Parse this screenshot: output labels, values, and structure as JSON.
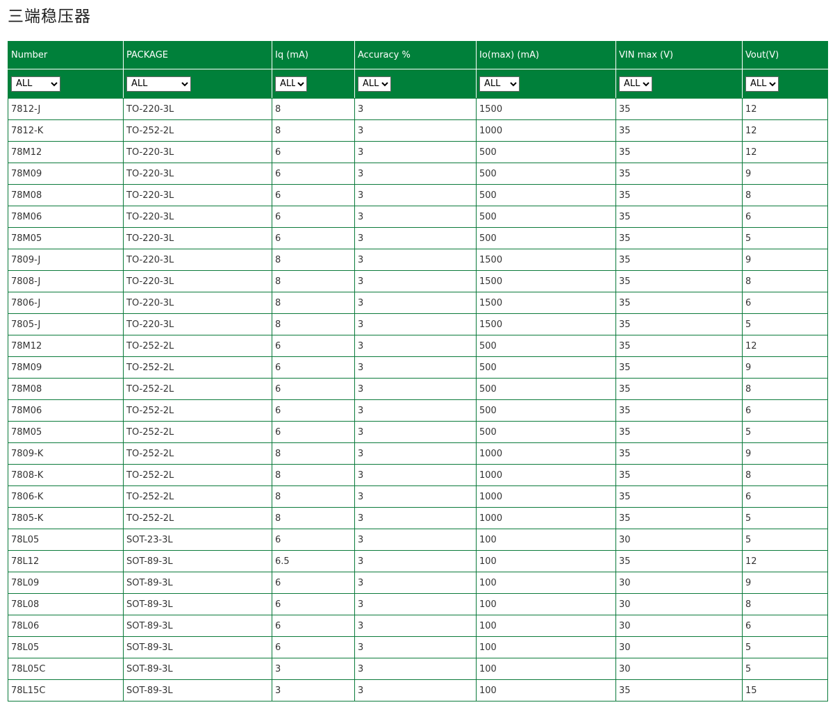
{
  "page": {
    "title": "三端稳压器"
  },
  "table": {
    "columns": [
      {
        "key": "number",
        "label": "Number",
        "filter": "ALL"
      },
      {
        "key": "package",
        "label": "PACKAGE",
        "filter": "ALL"
      },
      {
        "key": "iq",
        "label": "Iq (mA)",
        "filter": "ALL"
      },
      {
        "key": "accuracy",
        "label": "Accuracy %",
        "filter": "ALL"
      },
      {
        "key": "iomax",
        "label": "Io(max) (mA)",
        "filter": "ALL"
      },
      {
        "key": "vinmax",
        "label": "VIN max (V)",
        "filter": "ALL"
      },
      {
        "key": "vout",
        "label": "Vout(V)",
        "filter": "ALL"
      }
    ],
    "rows": [
      [
        "7812-J",
        "TO-220-3L",
        "8",
        "3",
        "1500",
        "35",
        "12"
      ],
      [
        "7812-K",
        "TO-252-2L",
        "8",
        "3",
        "1000",
        "35",
        "12"
      ],
      [
        "78M12",
        "TO-220-3L",
        "6",
        "3",
        "500",
        "35",
        "12"
      ],
      [
        "78M09",
        "TO-220-3L",
        "6",
        "3",
        "500",
        "35",
        "9"
      ],
      [
        "78M08",
        "TO-220-3L",
        "6",
        "3",
        "500",
        "35",
        "8"
      ],
      [
        "78M06",
        "TO-220-3L",
        "6",
        "3",
        "500",
        "35",
        "6"
      ],
      [
        "78M05",
        "TO-220-3L",
        "6",
        "3",
        "500",
        "35",
        "5"
      ],
      [
        "7809-J",
        "TO-220-3L",
        "8",
        "3",
        "1500",
        "35",
        "9"
      ],
      [
        "7808-J",
        "TO-220-3L",
        "8",
        "3",
        "1500",
        "35",
        "8"
      ],
      [
        "7806-J",
        "TO-220-3L",
        "8",
        "3",
        "1500",
        "35",
        "6"
      ],
      [
        "7805-J",
        "TO-220-3L",
        "8",
        "3",
        "1500",
        "35",
        "5"
      ],
      [
        "78M12",
        "TO-252-2L",
        "6",
        "3",
        "500",
        "35",
        "12"
      ],
      [
        "78M09",
        "TO-252-2L",
        "6",
        "3",
        "500",
        "35",
        "9"
      ],
      [
        "78M08",
        "TO-252-2L",
        "6",
        "3",
        "500",
        "35",
        "8"
      ],
      [
        "78M06",
        "TO-252-2L",
        "6",
        "3",
        "500",
        "35",
        "6"
      ],
      [
        "78M05",
        "TO-252-2L",
        "6",
        "3",
        "500",
        "35",
        "5"
      ],
      [
        "7809-K",
        "TO-252-2L",
        "8",
        "3",
        "1000",
        "35",
        "9"
      ],
      [
        "7808-K",
        "TO-252-2L",
        "8",
        "3",
        "1000",
        "35",
        "8"
      ],
      [
        "7806-K",
        "TO-252-2L",
        "8",
        "3",
        "1000",
        "35",
        "6"
      ],
      [
        "7805-K",
        "TO-252-2L",
        "8",
        "3",
        "1000",
        "35",
        "5"
      ],
      [
        "78L05",
        "SOT-23-3L",
        "6",
        "3",
        "100",
        "30",
        "5"
      ],
      [
        "78L12",
        "SOT-89-3L",
        "6.5",
        "3",
        "100",
        "35",
        "12"
      ],
      [
        "78L09",
        "SOT-89-3L",
        "6",
        "3",
        "100",
        "30",
        "9"
      ],
      [
        "78L08",
        "SOT-89-3L",
        "6",
        "3",
        "100",
        "30",
        "8"
      ],
      [
        "78L06",
        "SOT-89-3L",
        "6",
        "3",
        "100",
        "30",
        "6"
      ],
      [
        "78L05",
        "SOT-89-3L",
        "6",
        "3",
        "100",
        "30",
        "5"
      ],
      [
        "78L05C",
        "SOT-89-3L",
        "3",
        "3",
        "100",
        "30",
        "5"
      ],
      [
        "78L15C",
        "SOT-89-3L",
        "3",
        "3",
        "100",
        "35",
        "15"
      ]
    ]
  },
  "colors": {
    "header_bg": "#00803a",
    "border": "#0a7a3a"
  }
}
